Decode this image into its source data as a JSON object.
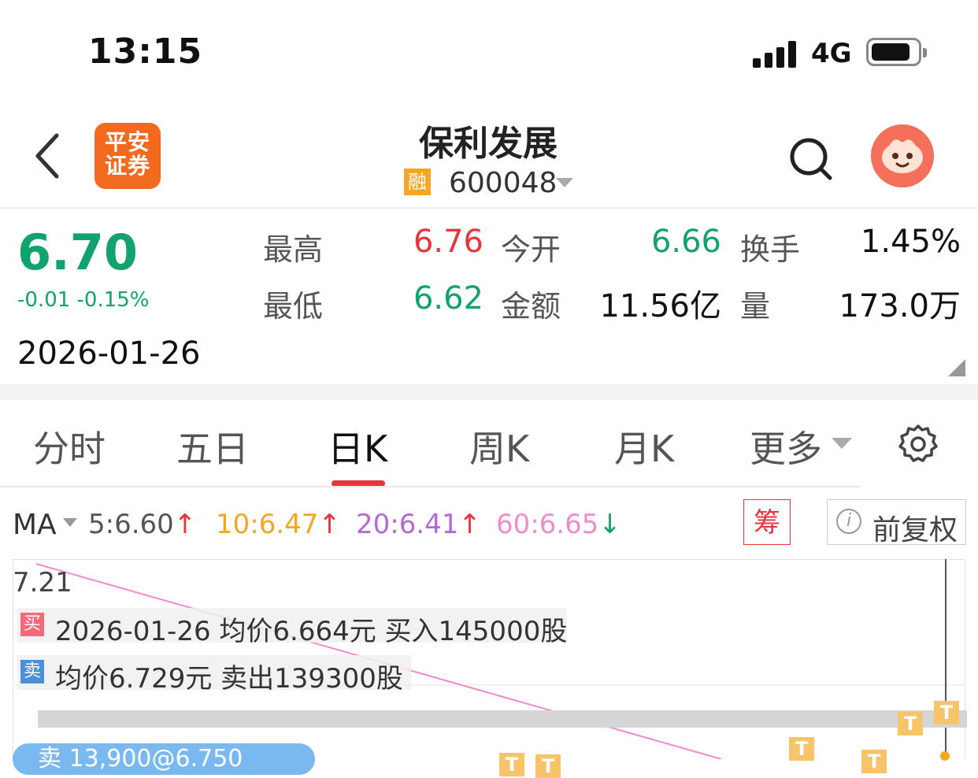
{
  "status_bar": {
    "time": "13:15",
    "network": "4G"
  },
  "header": {
    "logo_line1": "平安",
    "logo_line2": "证券",
    "stock_name": "保利发展",
    "margin_tag": "融",
    "stock_code": "600048",
    "icons": [
      "back-icon",
      "search-icon",
      "assistant-avatar-icon"
    ]
  },
  "quote": {
    "price": "6.70",
    "change": "-0.01 -0.15%",
    "date": "2026-01-26",
    "high_label": "最高",
    "high_value": "6.76",
    "open_label": "今开",
    "open_value": "6.66",
    "turnover_label": "换手",
    "turnover_value": "1.45%",
    "low_label": "最低",
    "low_value": "6.62",
    "amount_label": "金额",
    "amount_value": "11.56亿",
    "volume_label": "量",
    "volume_value": "173.0万",
    "colors": {
      "up": "#e7343d",
      "down": "#11a36b"
    }
  },
  "tabs": [
    {
      "label": "分时"
    },
    {
      "label": "五日"
    },
    {
      "label": "日K",
      "active": true
    },
    {
      "label": "周K"
    },
    {
      "label": "月K"
    },
    {
      "label": "更多"
    }
  ],
  "ma": {
    "label": "MA",
    "items": [
      {
        "text": "5:6.60",
        "arrow": "↑",
        "color": "#555555",
        "arrow_color": "#e7343d"
      },
      {
        "text": "10:6.47",
        "arrow": "↑",
        "color": "#f5a623",
        "arrow_color": "#e7343d"
      },
      {
        "text": "20:6.41",
        "arrow": "↑",
        "color": "#b36ad8",
        "arrow_color": "#e7343d"
      },
      {
        "text": "60:6.65",
        "arrow": "↓",
        "color": "#f08ccb",
        "arrow_color": "#11a36b"
      }
    ],
    "chip_button": "筹",
    "adjust_button": "前复权"
  },
  "chart": {
    "y_max_label": "7.21",
    "buy_badge": "买",
    "buy_text": "2026-01-26 均价6.664元 买入145000股",
    "sell_badge": "卖",
    "sell_text": "均价6.729元 卖出139300股",
    "t_marker": "T",
    "sell_pill": "卖 13,900@6.750"
  }
}
